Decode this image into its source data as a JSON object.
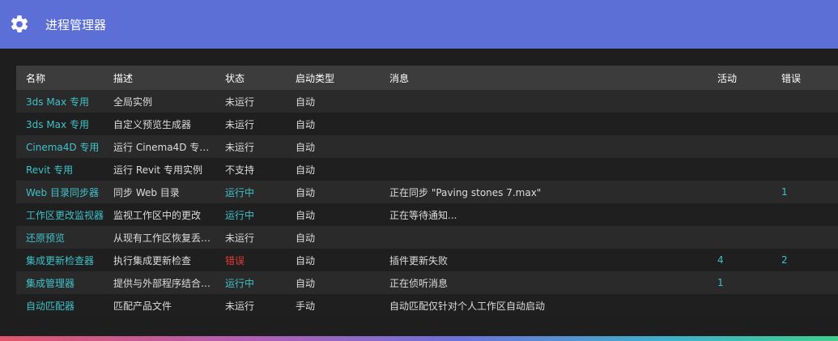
{
  "app": {
    "title": "进程管理器",
    "icon": "gear-icon"
  },
  "colors": {
    "titlebar": "#5b6fd6",
    "accent": "#3fc1c9",
    "error": "#e53935"
  },
  "table": {
    "headers": {
      "name": "名称",
      "desc": "描述",
      "status": "状态",
      "start": "启动类型",
      "msg": "消息",
      "act": "活动",
      "err": "错误"
    },
    "rows": [
      {
        "name": "3ds Max 专用",
        "desc": "全局实例",
        "status": "未运行",
        "status_kind": "stopped",
        "start": "自动",
        "msg": "",
        "act": "",
        "err": ""
      },
      {
        "name": "3ds Max 专用",
        "desc": "自定义预览生成器",
        "status": "未运行",
        "status_kind": "stopped",
        "start": "自动",
        "msg": "",
        "act": "",
        "err": ""
      },
      {
        "name": "Cinema4D 专用",
        "desc": "运行 Cinema4D 专用…",
        "status": "未运行",
        "status_kind": "stopped",
        "start": "自动",
        "msg": "",
        "act": "",
        "err": ""
      },
      {
        "name": "Revit 专用",
        "desc": "运行 Revit 专用实例",
        "status": "不支持",
        "status_kind": "unsupported",
        "start": "自动",
        "msg": "",
        "act": "",
        "err": ""
      },
      {
        "name": "Web 目录同步器",
        "desc": "同步 Web 目录",
        "status": "运行中",
        "status_kind": "running",
        "start": "自动",
        "msg": "正在同步 \"Paving stones 7.max\"",
        "act": "",
        "err": "1"
      },
      {
        "name": "工作区更改监视器",
        "desc": "监视工作区中的更改",
        "status": "运行中",
        "status_kind": "running",
        "start": "自动",
        "msg": "正在等待通知...",
        "act": "",
        "err": ""
      },
      {
        "name": "还原预览",
        "desc": "从现有工作区恢复丢…",
        "status": "未运行",
        "status_kind": "stopped",
        "start": "自动",
        "msg": "",
        "act": "",
        "err": ""
      },
      {
        "name": "集成更新检查器",
        "desc": "执行集成更新检查",
        "status": "错误",
        "status_kind": "error",
        "start": "自动",
        "msg": "插件更新失败",
        "act": "4",
        "err": "2"
      },
      {
        "name": "集成管理器",
        "desc": "提供与外部程序结合…",
        "status": "运行中",
        "status_kind": "running",
        "start": "自动",
        "msg": "正在侦听消息",
        "act": "1",
        "err": ""
      },
      {
        "name": "自动匹配器",
        "desc": "匹配产品文件",
        "status": "未运行",
        "status_kind": "stopped",
        "start": "手动",
        "msg": "自动匹配仅针对个人工作区自动启动",
        "act": "",
        "err": ""
      }
    ]
  }
}
